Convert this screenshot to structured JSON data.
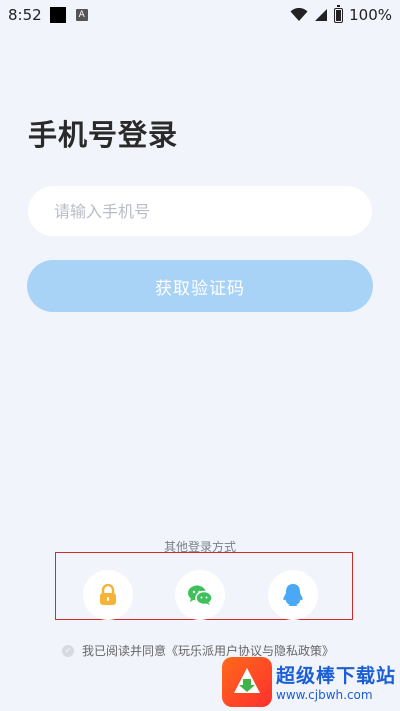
{
  "status_bar": {
    "time": "8:52",
    "battery_text": "100%"
  },
  "login": {
    "title": "手机号登录",
    "phone_placeholder": "请输入手机号",
    "phone_value": "",
    "get_code_label": "获取验证码"
  },
  "other_login": {
    "label": "其他登录方式",
    "options": [
      {
        "icon": "lock-icon",
        "color": "#f5b437"
      },
      {
        "icon": "wechat-icon",
        "color": "#3ec05a"
      },
      {
        "icon": "qq-icon",
        "color": "#4aa8f5"
      }
    ]
  },
  "agreement": {
    "text": "我已阅读并同意《玩乐派用户协议与隐私政策》",
    "checked": false
  },
  "watermark": {
    "title": "超级棒下载站",
    "url": "www.cjbwh.com"
  },
  "colors": {
    "background": "#f1f4fa",
    "primary_button": "#a8d3f6",
    "highlight_border": "#d22b2b"
  }
}
